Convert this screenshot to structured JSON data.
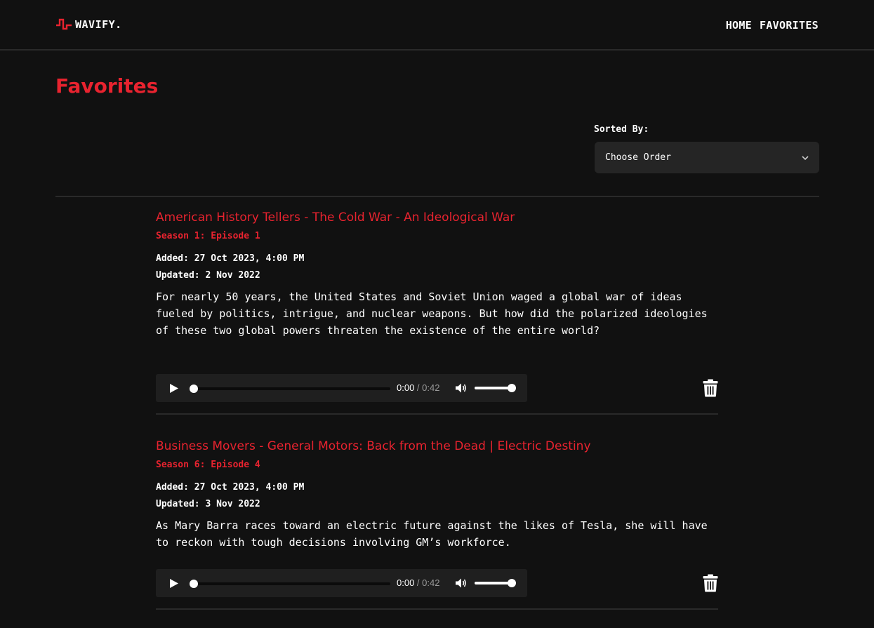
{
  "nav": {
    "brand": "WAVIFY.",
    "links": [
      "HOME",
      "FAVORITES"
    ]
  },
  "page": {
    "title": "Favorites"
  },
  "sort": {
    "label": "Sorted By:",
    "selected": "Choose Order"
  },
  "episodes": [
    {
      "title": "American History Tellers - The Cold War - An Ideological War",
      "season": "Season 1: Episode 1",
      "added": "Added: 27 Oct 2023, 4:00 PM",
      "updated": "Updated: 2 Nov 2022",
      "description": "For nearly 50 years, the United States and Soviet Union waged a global war of ideas fueled by politics, intrigue, and nuclear weapons. But how did the polarized ideologies of these two global powers threaten the existence of the entire world?",
      "player": {
        "current": "0:00",
        "separator": " / ",
        "duration": "0:42",
        "progress": 0,
        "volume": 1
      }
    },
    {
      "title": "Business Movers - General Motors: Back from the Dead | Electric Destiny",
      "season": "Season 6: Episode 4",
      "added": "Added: 27 Oct 2023, 4:00 PM",
      "updated": "Updated: 3 Nov 2022",
      "description": "As Mary Barra races toward an electric future against the likes of Tesla, she will have to reckon with tough decisions involving GM’s workforce.",
      "player": {
        "current": "0:00",
        "separator": " / ",
        "duration": "0:42",
        "progress": 0,
        "volume": 1
      }
    }
  ],
  "icons": {
    "logo": "wave-pulse-icon",
    "sort": "chevron-down-icon",
    "play": "play-icon",
    "volume": "volume-icon",
    "delete": "trash-icon"
  },
  "colors": {
    "accent": "#e8232f",
    "background": "#111111",
    "surface": "#1f1f1f",
    "select": "#252525",
    "divider": "#2a2a2a"
  }
}
